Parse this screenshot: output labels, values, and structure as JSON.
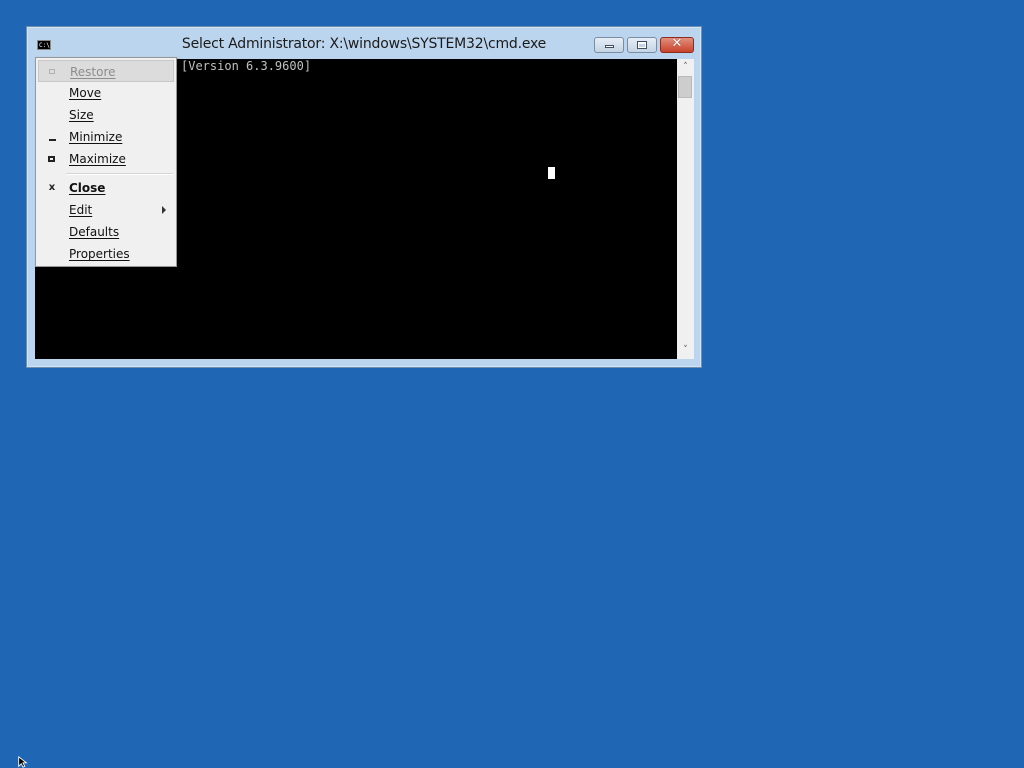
{
  "window": {
    "title": "Select Administrator: X:\\windows\\SYSTEM32\\cmd.exe",
    "app_icon_text": "C:\\.",
    "app_icon": "console-app-icon",
    "buttons": {
      "minimize_icon": "minimize-icon",
      "maximize_icon": "maximize-icon",
      "close_icon": "close-icon",
      "close_glyph": "✕"
    }
  },
  "console": {
    "visible_text": "[Version 6.3.9600]"
  },
  "system_menu": {
    "items": [
      {
        "label": "Restore",
        "icon": "restore-icon",
        "enabled": false,
        "highlighted": true
      },
      {
        "label": "Move",
        "icon": "",
        "enabled": true
      },
      {
        "label": "Size",
        "icon": "",
        "enabled": true
      },
      {
        "label": "Minimize",
        "icon": "minimize-icon",
        "enabled": true
      },
      {
        "label": "Maximize",
        "icon": "maximize-icon",
        "enabled": true
      },
      {
        "label": "Close",
        "icon": "close-icon",
        "enabled": true,
        "bold": true,
        "glyph": "x"
      },
      {
        "label": "Edit",
        "icon": "",
        "enabled": true,
        "submenu": true
      },
      {
        "label": "Defaults",
        "icon": "",
        "enabled": true
      },
      {
        "label": "Properties",
        "icon": "",
        "enabled": true
      }
    ]
  },
  "colors": {
    "desktop": "#1f67b4",
    "console_bg": "#000000",
    "console_fg": "#c0c0c0",
    "menu_bg": "#f0f0f0",
    "close_button": "#c8432b"
  }
}
